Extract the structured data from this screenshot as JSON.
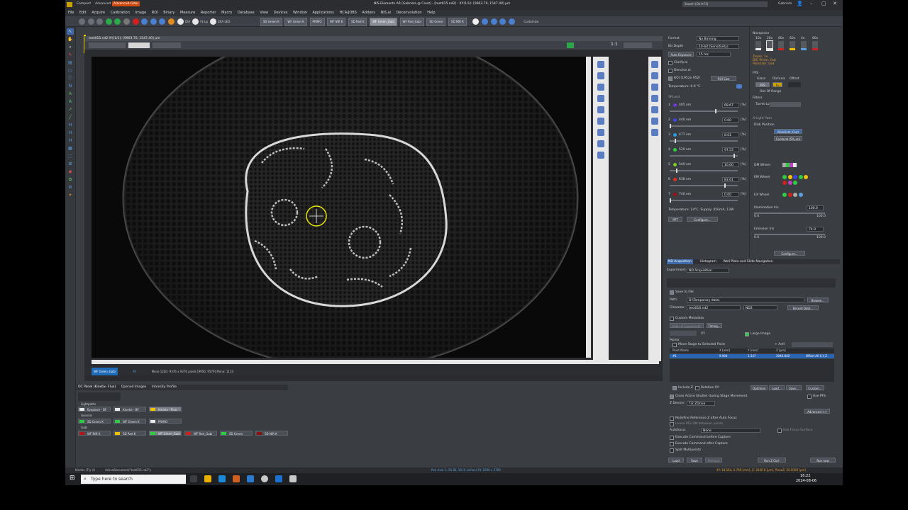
{
  "window": {
    "title": "NIS-Elements AR [Gabriela @ Crest] - [test015.nd2] - XY(1/1): [9903.70, 1547.40] µm",
    "search_placeholder": "Search (Ctrl+F3)",
    "user": "Gabriela",
    "layout_tabs": [
      "Compact",
      "Advanced",
      "Advanced-GAbi"
    ]
  },
  "menu": [
    "File",
    "Edit",
    "Acquire",
    "Calibration",
    "Image",
    "ROI",
    "Binary",
    "Measure",
    "Reporter",
    "Macro",
    "Database",
    "View",
    "Devices",
    "Window",
    "Applications",
    "HCA/JOBS",
    "Addons",
    "NIS.ai",
    "Deconvolution",
    "Help"
  ],
  "toolbar": {
    "illum_buttons": [
      "DIA",
      "FL-Lp",
      "ZEA LED"
    ],
    "preset_buttons": [
      "SD Green K",
      "WF Green K",
      "PRIMO",
      "WF NIR K",
      "SD Red K",
      "WF Green_Gabi",
      "WF Red_Gabi",
      "SD Green",
      "SD NIR K"
    ],
    "active_preset": "WF Green_Gabi",
    "customize": "Customize"
  },
  "viewer": {
    "doc_title": "test015.nd2   XY(1/1): [9903.70, 1547.40] µm",
    "info_strip": "Mono 12bit: 9376 x 9376 pixels     [9950, 9579] Mono: 1110",
    "zoom_label": "1:1",
    "oc_label": "WF Green_Gabi",
    "xy_label": "XY"
  },
  "oc_panel": {
    "tabs": [
      "OC Panel (Kinetix- Fluo)",
      "Opened Images",
      "Intensity Profile"
    ],
    "lightpaths_label": "Lightpaths",
    "lightpaths": [
      "Eyepiece - BF",
      "Kinetix - BF",
      "Kinetix - Fluo"
    ],
    "general_label": "General",
    "general": [
      "SD Green K",
      "WF Green K",
      "PRIMO"
    ],
    "gabi_label": "Gabi",
    "gabi": [
      "WF NIR K",
      "SD Red K",
      "WF Green_Gabi",
      "WF Red_Gabi",
      "SD Green",
      "SD NIR K"
    ],
    "colors": {
      "green": "#2ecc40",
      "yellow": "#f2c200",
      "red": "#b01818",
      "white": "#e8e8e8"
    }
  },
  "camera": {
    "format_label": "Format",
    "format_value": "No Binning",
    "bitdepth_label": "Bit Depth",
    "bitdepth_value": "10-bit (Sensitivity)",
    "autoexp_label": "Auto Exposure",
    "exposure_value": "15 ms",
    "clarify": "Clarify.ai",
    "denoise": "Denoise.ai",
    "roi_label": "ROI (1952x 952)",
    "roi_size": "ROI Size",
    "temperature": "Temperature: 0.0 °C",
    "laser_header": "SPLand",
    "lasers": [
      {
        "n": "1",
        "name": "405 nm",
        "value": "69.67",
        "color": "#6b38d8",
        "frac": 0.7
      },
      {
        "n": "2",
        "name": "440 nm",
        "value": "0.00",
        "color": "#3d46e0",
        "frac": 0.0
      },
      {
        "n": "3",
        "name": "477 nm",
        "value": "8.01",
        "color": "#2a9be5",
        "frac": 0.08
      },
      {
        "n": "4",
        "name": "520 nm",
        "value": "97.53",
        "color": "#2ecc40",
        "frac": 0.975
      },
      {
        "n": "5",
        "name": "540 nm",
        "value": "10.00",
        "color": "#7acc20",
        "frac": 0.1
      },
      {
        "n": "6",
        "name": "638 nm",
        "value": "83.61",
        "color": "#e03020",
        "frac": 0.836
      },
      {
        "n": "7",
        "name": "740 nm",
        "value": "0.00",
        "color": "#a01010",
        "frac": 0.0
      }
    ],
    "temp_supply": "Temperature: 24°C, Supply: 450mA, 13W",
    "ppt": "PPT",
    "configure": "Configure..."
  },
  "lights": {
    "nosepiece": "Nosepiece",
    "objectives": [
      "10x",
      "20x",
      "60x",
      "60x",
      "4x",
      "60x"
    ],
    "zoom": "Zoom: 1x",
    "dic_prism": "DIC Prism: Out",
    "polarizer": "Polarizer: Out",
    "pfs_label": "PFS",
    "pfs_glass": "Glass",
    "pfs_dichroic": "Dichroic",
    "pfs_offset": "Offset",
    "pfs_btn": "PFS",
    "pfs_in": "In",
    "out_of_range": "Out Of Range",
    "filters": "Filters",
    "turret": "Turret-Lo",
    "light_path": "X-Light Path",
    "disk_position": "Disk Position",
    "widefield": "Widefield (Out)",
    "confocal": "Confocal (50 µm)",
    "dm_wheel": "DM Wheel",
    "em_wheel": "EM Wheel",
    "ex_wheel": "EX Wheel",
    "illum_iris": "Illumination Iris",
    "illum_iris_value": "100.0",
    "illum_min": "0.0",
    "illum_max": "100.0",
    "emission_iris": "Emission Iris",
    "emission_value": "74.0",
    "emission_min": "0.0",
    "emission_max": "100.0",
    "configure": "Configure..."
  },
  "nd": {
    "tabs": [
      "ND Acquisition",
      "Histogram",
      "Well Plate and Slide Navigation"
    ],
    "experiment_label": "Experiment:",
    "experiment_value": "ND Acquisition",
    "save_to_file": "Save to File",
    "path_label": "Path:",
    "path_value": "D:\\Temporary data\\",
    "browse": "Browse...",
    "filename_label": "Filename:",
    "filename_value": "test016.nd2",
    "format": "ND2",
    "record_data": "Record Data...",
    "custom_metadata": "Custom Metadata",
    "order_of_experiment": "Order of Experiment:",
    "timing": "Timing...",
    "xy": "XY",
    "large_image": "Large Image",
    "points": "Points",
    "move_stage": "Move Stage to Selected Point",
    "add": "+ Add",
    "columns": [
      "Point Name",
      "X [mm]",
      "Y [mm]",
      "Z [µm]",
      ""
    ],
    "row": [
      "#1",
      "9.904",
      "1.547",
      "2040.840",
      "Offset All X,Y,Z"
    ],
    "include_z": "Include Z",
    "relative_xy": "Relative XY",
    "optimize": "Optimize",
    "load": "Load...",
    "save": "Save...",
    "custom": "Custom...",
    "close_shutter": "Close Active Shutter during Stage Movement",
    "use_pfs": "Use PFS",
    "z_device": "Z Device:",
    "z_device_value": "Ti2 ZDrive",
    "advanced": "Advanced <<",
    "redefine_z": "Redefine Reference Z after Auto Focus",
    "leave_pfs": "Leave PFS ON between points",
    "autofocus_label": "Autofocus",
    "autofocus_value": "None",
    "use_focus": "Use Focus Surface",
    "exec_before": "Execute Command before Capture",
    "exec_after": "Execute Command after Capture",
    "split": "Split Multipoints",
    "bottom_load": "Load",
    "bottom_save": "Save",
    "remove": "Remove",
    "run_z": "Run Z Corr",
    "run_now": "Run now"
  },
  "status": {
    "left": "Kinetix (Fly V)",
    "active_doc": "ActiveDocument(\"test015.nd2\");",
    "mid": "Pan Axis: 1.3% ID: 18 (0 inches) XY: 1900 x 3700",
    "right": "XY: 18.564, 0.789 [mm], Z: 2040.8 [µm], PiezoZ: 50.0000 [µm]"
  },
  "taskbar": {
    "search": "Type here to search",
    "time": "16:22",
    "date": "2024-08-06"
  }
}
